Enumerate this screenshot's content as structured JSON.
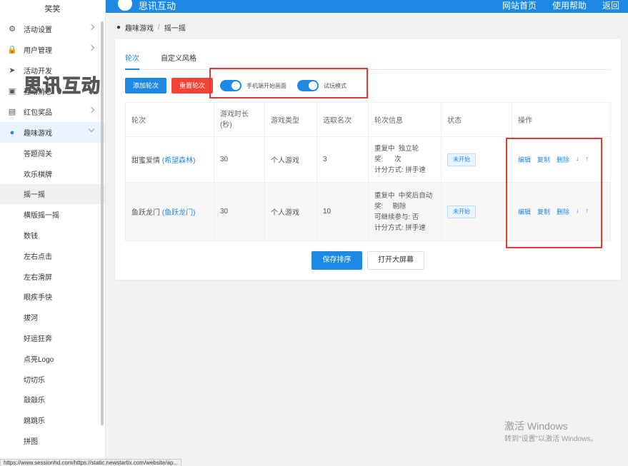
{
  "sidebar": {
    "top_label": "笑笑",
    "items": [
      {
        "label": "活动设置",
        "icon": "gears-icon"
      },
      {
        "label": "用户管理",
        "icon": "user-lock-icon"
      },
      {
        "label": "活动开发",
        "icon": "paper-plane-icon"
      },
      {
        "label": "互动消息",
        "icon": "message-icon"
      },
      {
        "label": "红包奖品",
        "icon": "gift-icon"
      },
      {
        "label": "趣味游戏",
        "icon": "game-icon"
      }
    ],
    "sub_items": [
      "答题闯关",
      "欢乐棋牌",
      "摇一摇",
      "横版摇一摇",
      "数钱",
      "左右点击",
      "左右滑屏",
      "眼疾手快",
      "拔河",
      "好运狂奔",
      "点亮Logo",
      "切切乐",
      "敲敲乐",
      "跳跳乐",
      "拼图"
    ]
  },
  "watermark": "思讯互动",
  "topbar": {
    "brand": "思讯互动",
    "nav": [
      "网站首页",
      "使用帮助",
      "返回"
    ]
  },
  "breadcrumb": {
    "parent": "趣味游戏",
    "separator": "/",
    "current": "摇一摇"
  },
  "tabs": [
    "轮次",
    "自定义风格"
  ],
  "buttons": {
    "add": "添加轮次",
    "reset": "重置轮次",
    "save": "保存排序",
    "big_screen": "打开大屏幕"
  },
  "toggles": [
    {
      "label": "手机端开始画面",
      "on": true
    },
    {
      "label": "试玩模式",
      "on": true
    }
  ],
  "table": {
    "headers": [
      "轮次",
      "游戏时长\n(秒)",
      "游戏类型",
      "选取名次",
      "轮次信息",
      "状态",
      "操作"
    ],
    "rows": [
      {
        "name": "甜蜜爱情",
        "theme": "(希望森林)",
        "duration": "30",
        "type": "个人游戏",
        "rank": "3",
        "info": [
          "重复中  独立轮",
          "奖:      次",
          "计分方式: 拼手速"
        ],
        "status": "未开始"
      },
      {
        "name": "鱼跃龙门",
        "theme": "(鱼跃龙门)",
        "duration": "30",
        "type": "个人游戏",
        "rank": "10",
        "info": [
          "重复中  中奖后自动",
          "奖:     剔除",
          "可继续参与: 否",
          "计分方式: 拼手速"
        ],
        "status": "未开始"
      }
    ],
    "ops": [
      "编辑",
      "复制",
      "删除",
      "↓",
      "↑"
    ]
  },
  "windows_activation": {
    "title": "激活 Windows",
    "subtitle": "转到\"设置\"以激活 Windows。"
  },
  "status_url": "https://www.sessionhd.com/https://static.newstartix.com/website/ap..."
}
